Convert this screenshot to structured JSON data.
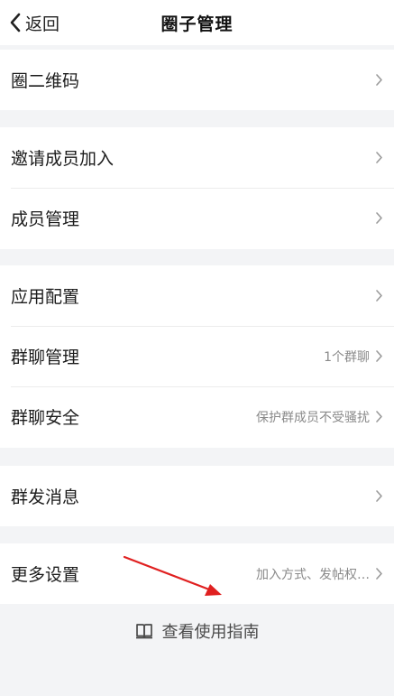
{
  "header": {
    "back_label": "返回",
    "title": "圈子管理"
  },
  "sections": [
    {
      "rows": [
        {
          "label": "圈二维码",
          "value": ""
        }
      ]
    },
    {
      "rows": [
        {
          "label": "邀请成员加入",
          "value": ""
        },
        {
          "label": "成员管理",
          "value": ""
        }
      ]
    },
    {
      "rows": [
        {
          "label": "应用配置",
          "value": ""
        },
        {
          "label": "群聊管理",
          "value": "1个群聊"
        },
        {
          "label": "群聊安全",
          "value": "保护群成员不受骚扰"
        }
      ]
    },
    {
      "rows": [
        {
          "label": "群发消息",
          "value": ""
        }
      ]
    },
    {
      "rows": [
        {
          "label": "更多设置",
          "value": "加入方式、发帖权…"
        }
      ]
    }
  ],
  "guide": {
    "label": "查看使用指南",
    "icon": "book-icon"
  },
  "icons": {
    "back": "chevron-left-icon",
    "row_arrow": "chevron-right-icon"
  },
  "colors": {
    "background": "#f3f4f6",
    "card": "#ffffff",
    "annotation_arrow": "#e02020"
  }
}
